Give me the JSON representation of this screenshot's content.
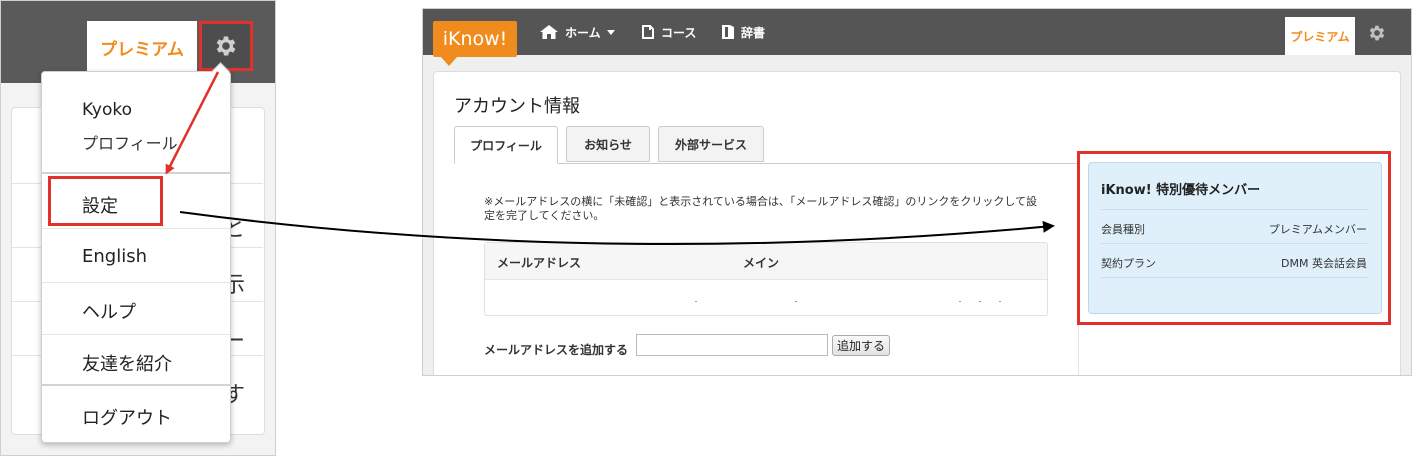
{
  "left_screenshot": {
    "header": {
      "premium_label": "プレミアム",
      "settings_icon": "gear-icon"
    },
    "dropdown_menu": {
      "user_name": "Kyoko",
      "profile_label": "プロフィール",
      "items": [
        {
          "label": "設定"
        },
        {
          "label": "English"
        },
        {
          "label": "ヘルプ"
        },
        {
          "label": "友達を紹介"
        },
        {
          "label": "ログアウト"
        }
      ]
    },
    "partial_background_glyphs": [
      "と",
      "示",
      "ー",
      "す"
    ]
  },
  "right_screenshot": {
    "header": {
      "logo_text": "iKnow!",
      "nav": [
        {
          "icon": "home-icon",
          "label": "ホーム"
        },
        {
          "icon": "course-icon",
          "label": "コース"
        },
        {
          "icon": "dictionary-icon",
          "label": "辞書"
        }
      ],
      "premium_label": "プレミアム",
      "settings_icon": "gear-icon"
    },
    "page_title": "アカウント情報",
    "tabs": [
      {
        "label": "プロフィール",
        "active": true
      },
      {
        "label": "お知らせ",
        "active": false
      },
      {
        "label": "外部サービス",
        "active": false
      }
    ],
    "notice": "※メールアドレスの横に「未確認」と表示されている場合は、「メールアドレス確認」のリンクをクリックして設定を完了してください。",
    "email_table": {
      "columns": [
        "メールアドレス",
        "メイン"
      ]
    },
    "add_email": {
      "label": "メールアドレスを追加する",
      "value": "",
      "button": "追加する"
    },
    "membership": {
      "title": "iKnow! 特別優待メンバー",
      "rows": [
        {
          "label": "会員種別",
          "value": "プレミアムメンバー"
        },
        {
          "label": "契約プラン",
          "value": "DMM 英会話会員"
        }
      ]
    }
  },
  "annotation_colors": {
    "highlight": "#e0322b",
    "arrow_red": "#e0322b",
    "arrow_black": "#000000"
  }
}
